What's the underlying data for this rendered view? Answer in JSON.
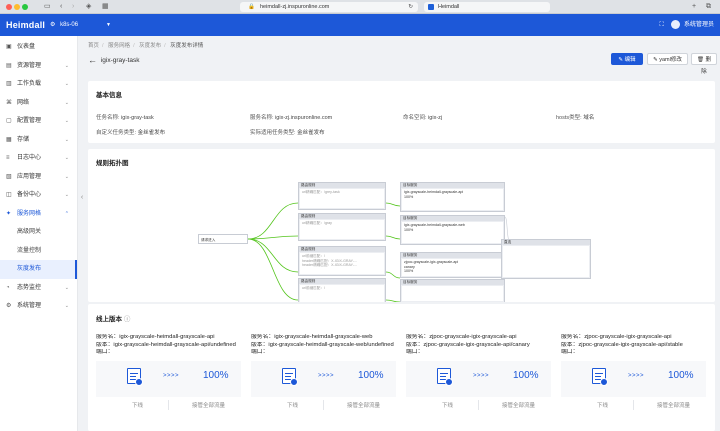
{
  "browser": {
    "url": "heimdall-zj.inspuronline.com",
    "tab_title": "Heimdall"
  },
  "header": {
    "logo": "Heimdall",
    "cluster": "k8s-06",
    "user": "系统管理员"
  },
  "sidebar": {
    "items": [
      {
        "label": "仪表盘",
        "icon": "dashboard-icon"
      },
      {
        "label": "资源管理",
        "icon": "box-icon",
        "expandable": true
      },
      {
        "label": "工作负载",
        "icon": "layers-icon",
        "expandable": true
      },
      {
        "label": "网络",
        "icon": "network-icon",
        "expandable": true
      },
      {
        "label": "配置管理",
        "icon": "config-icon",
        "expandable": true
      },
      {
        "label": "存储",
        "icon": "storage-icon",
        "expandable": true
      },
      {
        "label": "日志中心",
        "icon": "log-icon",
        "expandable": true
      },
      {
        "label": "应用管理",
        "icon": "app-icon",
        "expandable": true
      },
      {
        "label": "备份中心",
        "icon": "backup-icon",
        "expandable": true
      },
      {
        "label": "服务网格",
        "icon": "mesh-icon",
        "expandable": true,
        "open": true
      },
      {
        "label": "高级网关",
        "sub": true
      },
      {
        "label": "流量控制",
        "sub": true
      },
      {
        "label": "灰度发布",
        "sub": true,
        "active": true
      },
      {
        "label": "态势监控",
        "icon": "monitor-icon",
        "expandable": true
      },
      {
        "label": "系统管理",
        "icon": "settings-icon",
        "expandable": true
      }
    ]
  },
  "breadcrumb": [
    "首页",
    "服务网格",
    "灰度发布",
    "灰度发布详情"
  ],
  "page": {
    "title": "igix-gray-task",
    "buttons": {
      "edit": "编辑",
      "yaml": "yaml修改",
      "delete": "删除"
    }
  },
  "basic_info": {
    "title": "基本信息",
    "fields": [
      {
        "label": "任务名称:",
        "value": "igix-gray-task"
      },
      {
        "label": "服务名称:",
        "value": "igix-zj.inspuronline.com"
      },
      {
        "label": "命名空间:",
        "value": "igix-zj"
      },
      {
        "label": "hosts类型:",
        "value": "域名"
      },
      {
        "label": "自定义任务类型:",
        "value": "金丝雀发布"
      },
      {
        "label": "实际适用任务类型:",
        "value": "金丝雀发布"
      }
    ]
  },
  "topology": {
    "title": "规则拓扑图",
    "root": "请求进入",
    "rules": [
      {
        "head": "路由规则",
        "lines": [
          "url精确匹配：/grey-task"
        ]
      },
      {
        "head": "路由规则",
        "lines": [
          "url精确匹配：/gray"
        ]
      },
      {
        "head": "路由规则",
        "lines": [
          "url前缀匹配：/",
          "header精确匹配：X-IGIX-GRAY-...",
          "header精确匹配：X-IGIX-GRAY-..."
        ]
      },
      {
        "head": "路由规则",
        "lines": [
          "url前缀匹配：/"
        ]
      }
    ],
    "targets": [
      {
        "head": "目标服务",
        "lines": [
          "igix-grayscale-heimdall-grayscale-api",
          "",
          "",
          "",
          "100%"
        ]
      },
      {
        "head": "目标服务",
        "lines": [
          "igix-grayscale-heimdall-grayscale-web",
          "",
          "",
          "",
          "100%"
        ]
      },
      {
        "head": "目标服务",
        "lines": [
          "zjpoc-grayscale-igix-grayscale-api",
          "",
          "canary",
          "",
          "100%"
        ]
      },
      {
        "head": "目标服务",
        "lines": [
          "",
          "",
          "",
          ""
        ]
      }
    ],
    "extra": {
      "head": "直连"
    }
  },
  "online_versions": {
    "title": "线上版本",
    "cards": [
      {
        "service": "igix-grayscale-heimdall-grayscale-api",
        "version": "igix-grayscale-heimdall-grayscale-api/undefined",
        "port": "",
        "percent": "100%",
        "offline": "下线",
        "take_all": "接管全部流量"
      },
      {
        "service": "igix-grayscale-heimdall-grayscale-web",
        "version": "igix-grayscale-heimdall-grayscale-web/undefined",
        "port": "",
        "percent": "100%",
        "offline": "下线",
        "take_all": "接管全部流量"
      },
      {
        "service": "zjpoc-grayscale-igix-grayscale-api",
        "version": "zjpoc-grayscale-igix-grayscale-api/canary",
        "port": "",
        "percent": "100%",
        "offline": "下线",
        "take_all": "接管全部流量"
      },
      {
        "service": "zjpoc-grayscale-igix-grayscale-api",
        "version": "zjpoc-grayscale-igix-grayscale-api/stable",
        "port": "",
        "percent": "100%",
        "offline": "下线",
        "take_all": "接管全部流量"
      }
    ],
    "labels": {
      "service": "服务名：",
      "version": "版本：",
      "port": "端口："
    },
    "arrows": ">>>>"
  },
  "colors": {
    "primary": "#1d58d8",
    "edge": "#52c41a"
  }
}
